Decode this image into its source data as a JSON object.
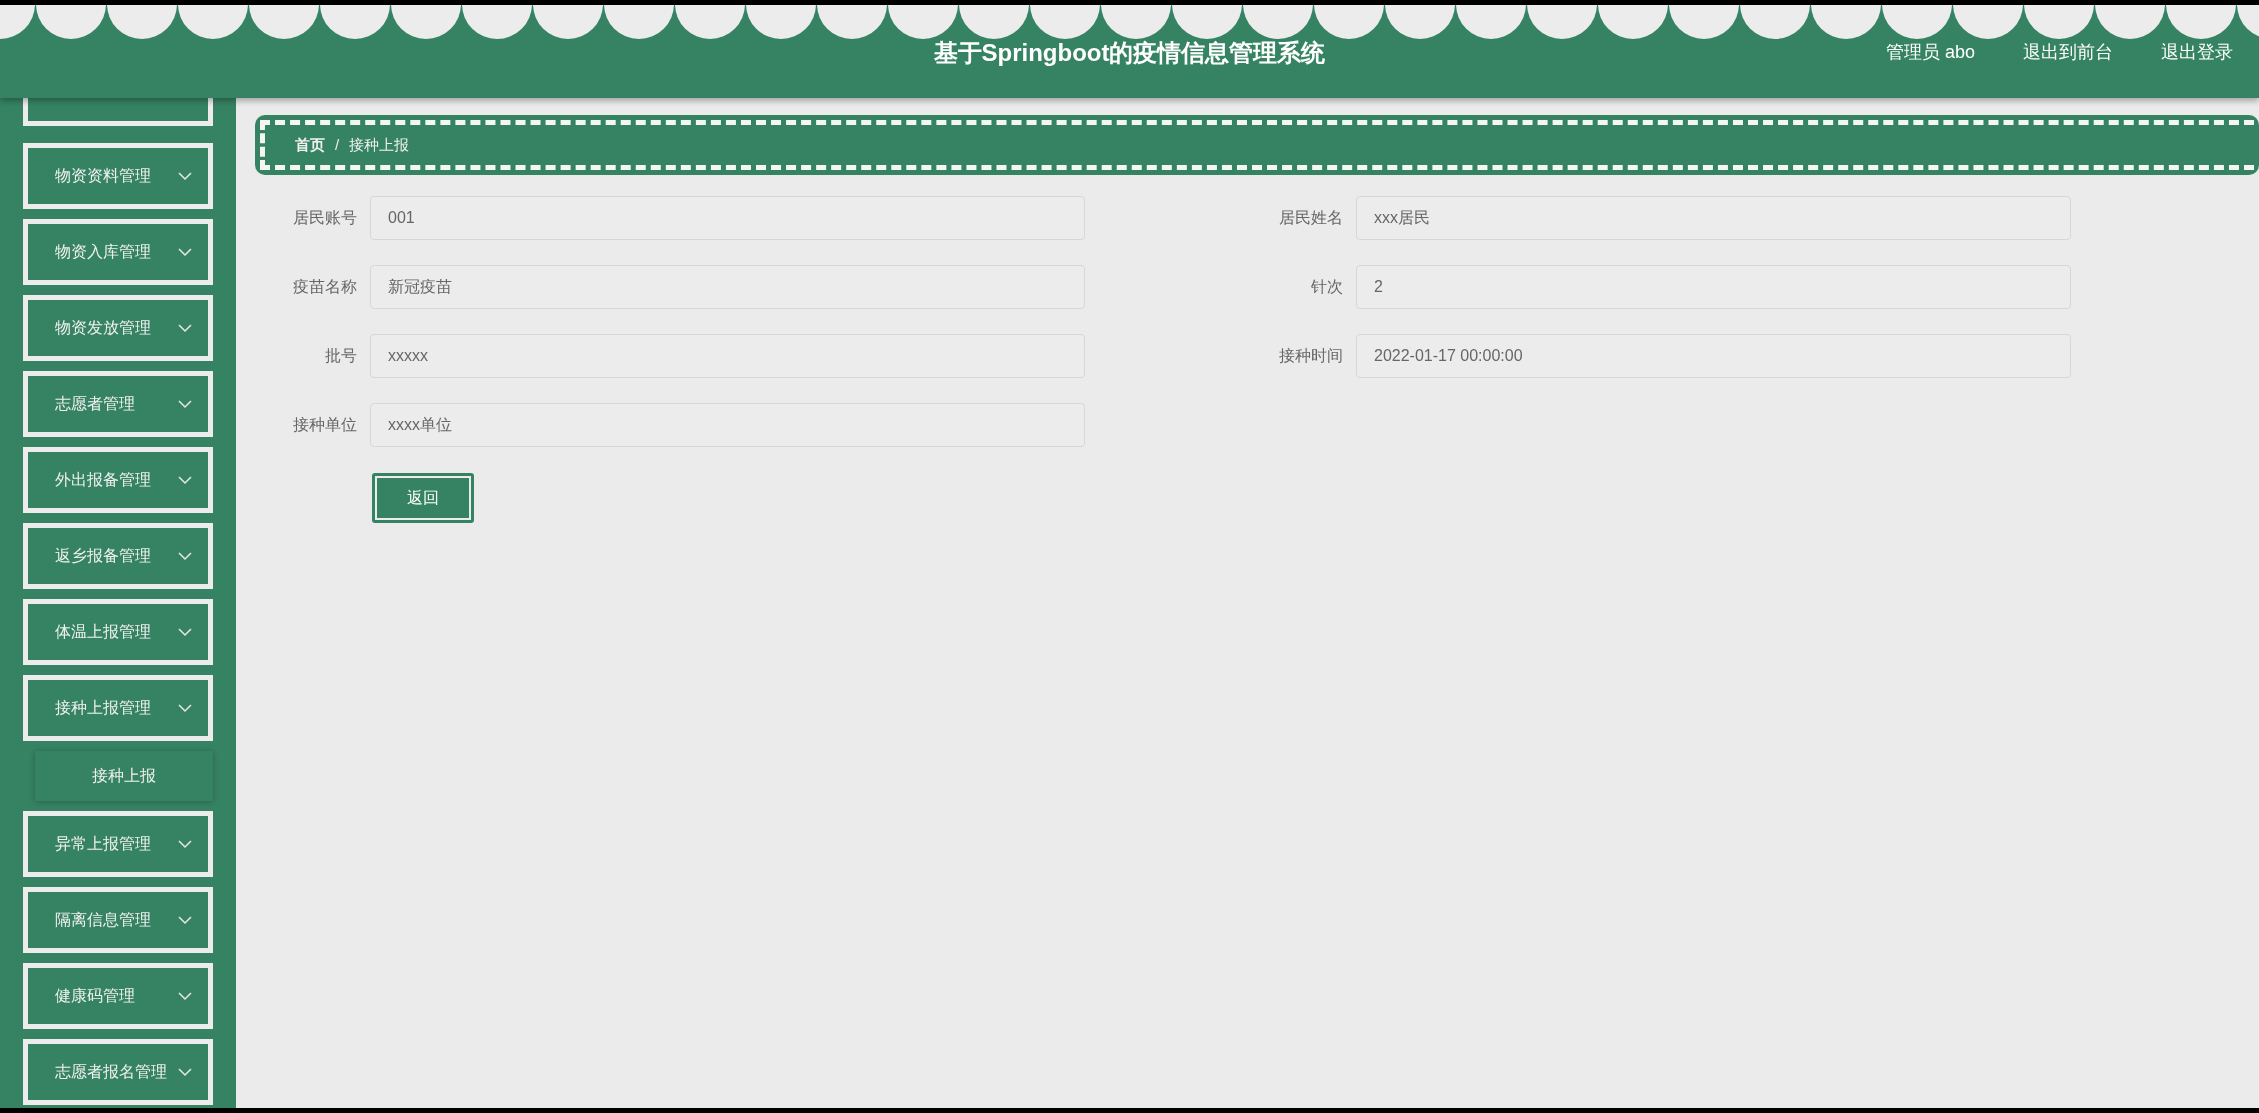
{
  "header": {
    "title": "基于Springboot的疫情信息管理系统",
    "user": "管理员 abo",
    "links": [
      "退出到前台",
      "退出登录"
    ]
  },
  "sidebar": {
    "items": [
      {
        "label": "物资资料管理"
      },
      {
        "label": "物资入库管理"
      },
      {
        "label": "物资发放管理"
      },
      {
        "label": "志愿者管理"
      },
      {
        "label": "外出报备管理"
      },
      {
        "label": "返乡报备管理"
      },
      {
        "label": "体温上报管理"
      },
      {
        "label": "接种上报管理",
        "children": [
          {
            "label": "接种上报"
          }
        ]
      },
      {
        "label": "异常上报管理"
      },
      {
        "label": "隔离信息管理"
      },
      {
        "label": "健康码管理"
      },
      {
        "label": "志愿者报名管理"
      }
    ]
  },
  "breadcrumb": {
    "items": [
      "首页",
      "接种上报"
    ],
    "separator": "/"
  },
  "form": {
    "fields": [
      {
        "label": "居民账号",
        "value": "001"
      },
      {
        "label": "居民姓名",
        "value": "xxx居民"
      },
      {
        "label": "疫苗名称",
        "value": "新冠疫苗"
      },
      {
        "label": "针次",
        "value": "2"
      },
      {
        "label": "批号",
        "value": "xxxxx"
      },
      {
        "label": "接种时间",
        "value": "2022-01-17 00:00:00"
      },
      {
        "label": "接种单位",
        "value": "xxxx单位"
      }
    ],
    "button": "返回"
  }
}
